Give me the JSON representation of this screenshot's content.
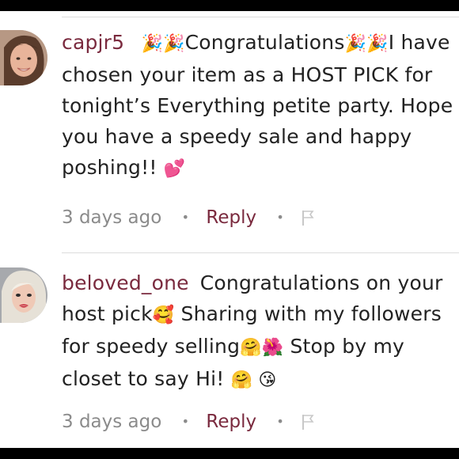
{
  "comments": [
    {
      "username": "capjr5",
      "body_parts": [
        {
          "text": " 🎉🎉",
          "emoji": true
        },
        {
          "text": "Congratulations",
          "emoji": false
        },
        {
          "text": "🎉🎉",
          "emoji": true
        },
        {
          "text": "I have chosen your item as a HOST PICK for tonight’s Everything petite party. Hope you have a speedy sale and happy poshing!! ",
          "emoji": false
        },
        {
          "text": "💕",
          "emoji": true
        }
      ],
      "time": "3 days ago",
      "reply_label": "Reply",
      "avatar_icon": "woman-smiling-avatar"
    },
    {
      "username": "beloved_one",
      "body_parts": [
        {
          "text": "Congratulations on your host pick",
          "emoji": false
        },
        {
          "text": "🥰",
          "emoji": true
        },
        {
          "text": " Sharing with my followers for speedy selling",
          "emoji": false
        },
        {
          "text": "🤗🌺",
          "emoji": true
        },
        {
          "text": " Stop by my closet to say Hi! ",
          "emoji": false
        },
        {
          "text": "🤗 😘",
          "emoji": true
        }
      ],
      "time": "3 days ago",
      "reply_label": "Reply",
      "avatar_icon": "blonde-woman-avatar"
    }
  ],
  "separator": "•",
  "colors": {
    "username": "#7a2a3e",
    "reply": "#7a2a3e",
    "meta": "#8b8b8b",
    "divider": "#dcdcdc"
  },
  "icons": {
    "flag": "flag-icon"
  }
}
